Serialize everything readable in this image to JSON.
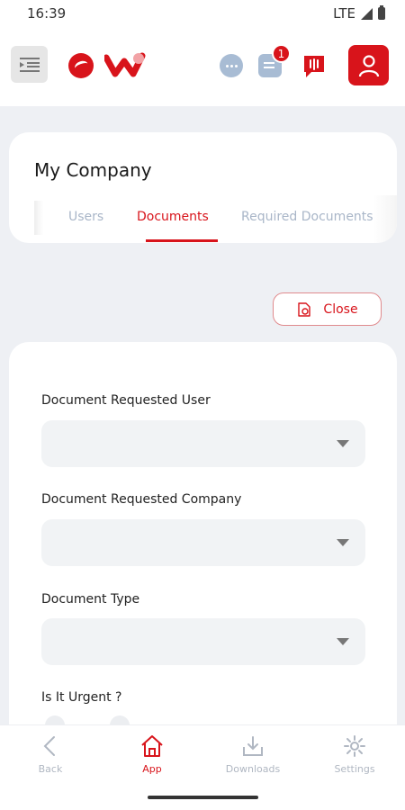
{
  "status_bar": {
    "time": "16:39",
    "network": "LTE"
  },
  "header": {
    "icons": [
      "menu-icon",
      "thy-logo-icon",
      "w-logo-icon",
      "chat-icon",
      "document-icon",
      "support-icon",
      "profile-icon"
    ],
    "notification_count": "1",
    "colors": {
      "brand": "#d8141b",
      "icon_muted": "#a8bcd4"
    }
  },
  "company": {
    "title": "My Company",
    "tabs": [
      {
        "label": "Users",
        "active": false
      },
      {
        "label": "Documents",
        "active": true
      },
      {
        "label": "Required Documents",
        "active": false
      }
    ]
  },
  "actions": {
    "close_label": "Close"
  },
  "form": {
    "fields": [
      {
        "label": "Document Requested User",
        "value": ""
      },
      {
        "label": "Document Requested Company",
        "value": ""
      },
      {
        "label": "Document Type",
        "value": ""
      }
    ],
    "urgent_label": "Is It Urgent ?"
  },
  "bottom_nav": {
    "items": [
      {
        "label": "Back",
        "icon": "chevron-left-icon",
        "active": false
      },
      {
        "label": "App",
        "icon": "home-icon",
        "active": true
      },
      {
        "label": "Downloads",
        "icon": "download-icon",
        "active": false
      },
      {
        "label": "Settings",
        "icon": "gear-icon",
        "active": false
      }
    ]
  }
}
